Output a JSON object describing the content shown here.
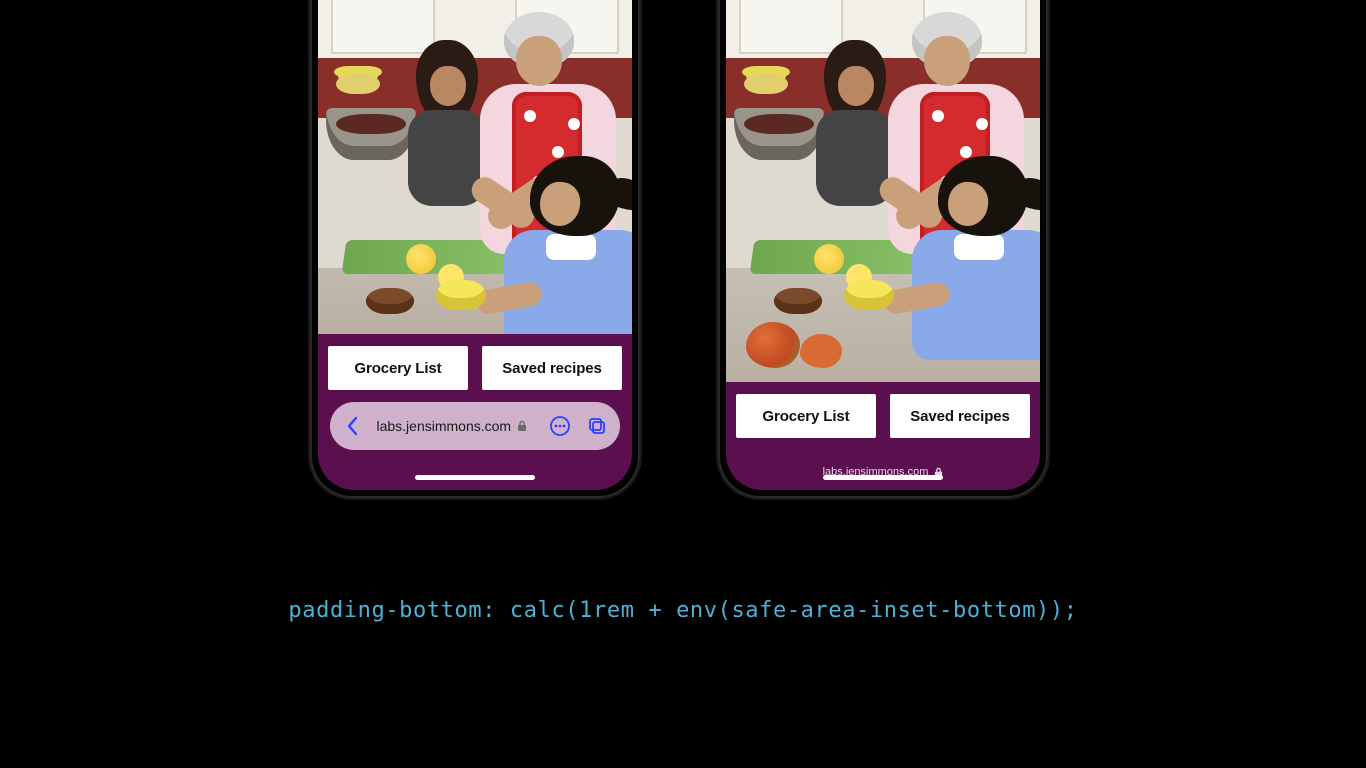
{
  "buttons": {
    "grocery": "Grocery List",
    "saved": "Saved recipes"
  },
  "safari": {
    "url": "labs.jensimmons.com"
  },
  "code": "padding-bottom: calc(1rem + env(safe-area-inset-bottom));"
}
